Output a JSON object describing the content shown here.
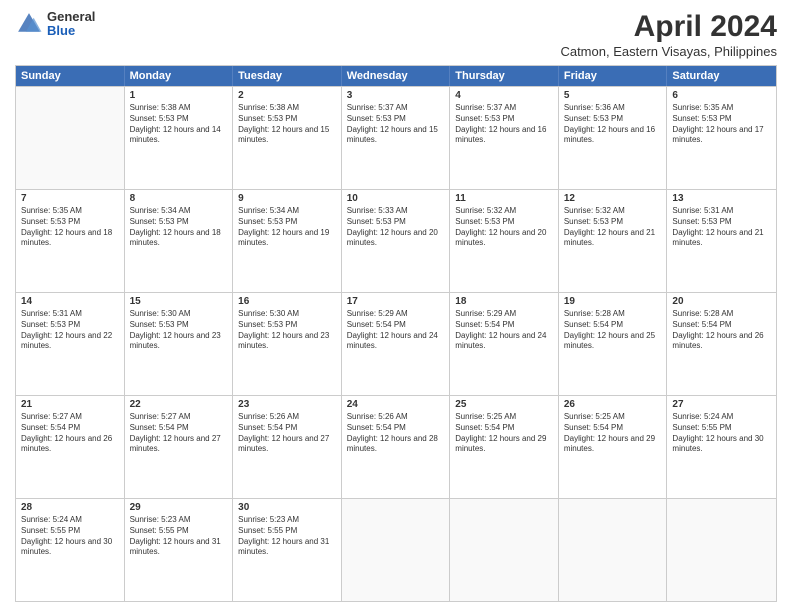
{
  "logo": {
    "general": "General",
    "blue": "Blue"
  },
  "title": "April 2024",
  "subtitle": "Catmon, Eastern Visayas, Philippines",
  "days": [
    "Sunday",
    "Monday",
    "Tuesday",
    "Wednesday",
    "Thursday",
    "Friday",
    "Saturday"
  ],
  "weeks": [
    [
      {
        "day": "",
        "empty": true
      },
      {
        "day": "1",
        "sunrise": "5:38 AM",
        "sunset": "5:53 PM",
        "daylight": "12 hours and 14 minutes."
      },
      {
        "day": "2",
        "sunrise": "5:38 AM",
        "sunset": "5:53 PM",
        "daylight": "12 hours and 15 minutes."
      },
      {
        "day": "3",
        "sunrise": "5:37 AM",
        "sunset": "5:53 PM",
        "daylight": "12 hours and 15 minutes."
      },
      {
        "day": "4",
        "sunrise": "5:37 AM",
        "sunset": "5:53 PM",
        "daylight": "12 hours and 16 minutes."
      },
      {
        "day": "5",
        "sunrise": "5:36 AM",
        "sunset": "5:53 PM",
        "daylight": "12 hours and 16 minutes."
      },
      {
        "day": "6",
        "sunrise": "5:35 AM",
        "sunset": "5:53 PM",
        "daylight": "12 hours and 17 minutes."
      }
    ],
    [
      {
        "day": "7",
        "sunrise": "5:35 AM",
        "sunset": "5:53 PM",
        "daylight": "12 hours and 18 minutes."
      },
      {
        "day": "8",
        "sunrise": "5:34 AM",
        "sunset": "5:53 PM",
        "daylight": "12 hours and 18 minutes."
      },
      {
        "day": "9",
        "sunrise": "5:34 AM",
        "sunset": "5:53 PM",
        "daylight": "12 hours and 19 minutes."
      },
      {
        "day": "10",
        "sunrise": "5:33 AM",
        "sunset": "5:53 PM",
        "daylight": "12 hours and 20 minutes."
      },
      {
        "day": "11",
        "sunrise": "5:32 AM",
        "sunset": "5:53 PM",
        "daylight": "12 hours and 20 minutes."
      },
      {
        "day": "12",
        "sunrise": "5:32 AM",
        "sunset": "5:53 PM",
        "daylight": "12 hours and 21 minutes."
      },
      {
        "day": "13",
        "sunrise": "5:31 AM",
        "sunset": "5:53 PM",
        "daylight": "12 hours and 21 minutes."
      }
    ],
    [
      {
        "day": "14",
        "sunrise": "5:31 AM",
        "sunset": "5:53 PM",
        "daylight": "12 hours and 22 minutes."
      },
      {
        "day": "15",
        "sunrise": "5:30 AM",
        "sunset": "5:53 PM",
        "daylight": "12 hours and 23 minutes."
      },
      {
        "day": "16",
        "sunrise": "5:30 AM",
        "sunset": "5:53 PM",
        "daylight": "12 hours and 23 minutes."
      },
      {
        "day": "17",
        "sunrise": "5:29 AM",
        "sunset": "5:54 PM",
        "daylight": "12 hours and 24 minutes."
      },
      {
        "day": "18",
        "sunrise": "5:29 AM",
        "sunset": "5:54 PM",
        "daylight": "12 hours and 24 minutes."
      },
      {
        "day": "19",
        "sunrise": "5:28 AM",
        "sunset": "5:54 PM",
        "daylight": "12 hours and 25 minutes."
      },
      {
        "day": "20",
        "sunrise": "5:28 AM",
        "sunset": "5:54 PM",
        "daylight": "12 hours and 26 minutes."
      }
    ],
    [
      {
        "day": "21",
        "sunrise": "5:27 AM",
        "sunset": "5:54 PM",
        "daylight": "12 hours and 26 minutes."
      },
      {
        "day": "22",
        "sunrise": "5:27 AM",
        "sunset": "5:54 PM",
        "daylight": "12 hours and 27 minutes."
      },
      {
        "day": "23",
        "sunrise": "5:26 AM",
        "sunset": "5:54 PM",
        "daylight": "12 hours and 27 minutes."
      },
      {
        "day": "24",
        "sunrise": "5:26 AM",
        "sunset": "5:54 PM",
        "daylight": "12 hours and 28 minutes."
      },
      {
        "day": "25",
        "sunrise": "5:25 AM",
        "sunset": "5:54 PM",
        "daylight": "12 hours and 29 minutes."
      },
      {
        "day": "26",
        "sunrise": "5:25 AM",
        "sunset": "5:54 PM",
        "daylight": "12 hours and 29 minutes."
      },
      {
        "day": "27",
        "sunrise": "5:24 AM",
        "sunset": "5:55 PM",
        "daylight": "12 hours and 30 minutes."
      }
    ],
    [
      {
        "day": "28",
        "sunrise": "5:24 AM",
        "sunset": "5:55 PM",
        "daylight": "12 hours and 30 minutes."
      },
      {
        "day": "29",
        "sunrise": "5:23 AM",
        "sunset": "5:55 PM",
        "daylight": "12 hours and 31 minutes."
      },
      {
        "day": "30",
        "sunrise": "5:23 AM",
        "sunset": "5:55 PM",
        "daylight": "12 hours and 31 minutes."
      },
      {
        "day": "",
        "empty": true
      },
      {
        "day": "",
        "empty": true
      },
      {
        "day": "",
        "empty": true
      },
      {
        "day": "",
        "empty": true
      }
    ]
  ]
}
